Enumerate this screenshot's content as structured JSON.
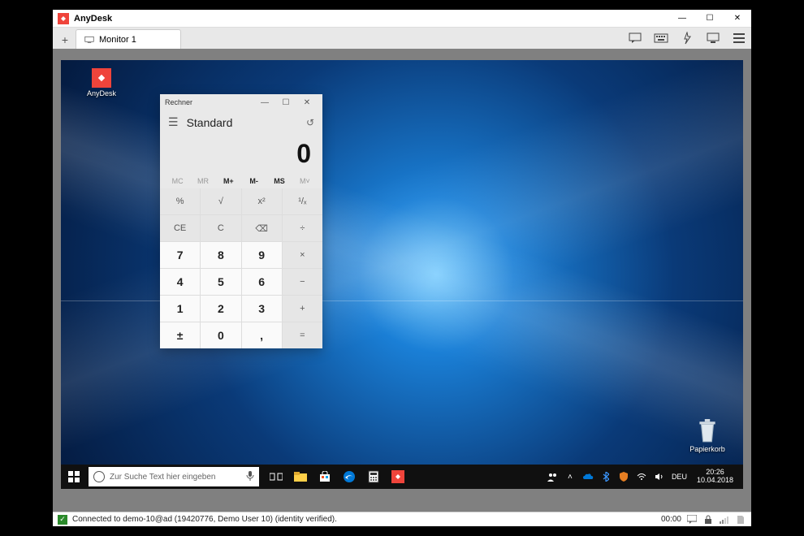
{
  "app": {
    "title": "AnyDesk"
  },
  "tabs": {
    "monitor_label": "Monitor 1"
  },
  "windowControls": {
    "minimize": "—",
    "maximize": "☐",
    "close": "✕"
  },
  "desktop": {
    "anydesk_label": "AnyDesk",
    "recycle_label": "Papierkorb"
  },
  "calculator": {
    "window_title": "Rechner",
    "mode": "Standard",
    "display": "0",
    "memory": {
      "mc": "MC",
      "mr": "MR",
      "mplus": "M+",
      "mminus": "M-",
      "ms": "MS",
      "mlist": "M˅"
    },
    "keys": {
      "percent": "%",
      "sqrt": "√",
      "sqr": "x²",
      "recip": "¹/ₓ",
      "ce": "CE",
      "c": "C",
      "back": "⌫",
      "div": "÷",
      "n7": "7",
      "n8": "8",
      "n9": "9",
      "mul": "×",
      "n4": "4",
      "n5": "5",
      "n6": "6",
      "sub": "−",
      "n1": "1",
      "n2": "2",
      "n3": "3",
      "add": "+",
      "neg": "±",
      "n0": "0",
      "dec": ",",
      "eq": "="
    }
  },
  "taskbar": {
    "search_placeholder": "Zur Suche Text hier eingeben",
    "lang": "DEU",
    "time": "20:26",
    "date": "10.04.2018"
  },
  "statusbar": {
    "text": "Connected to demo-10@ad (19420776, Demo User 10) (identity verified).",
    "timer": "00:00"
  }
}
